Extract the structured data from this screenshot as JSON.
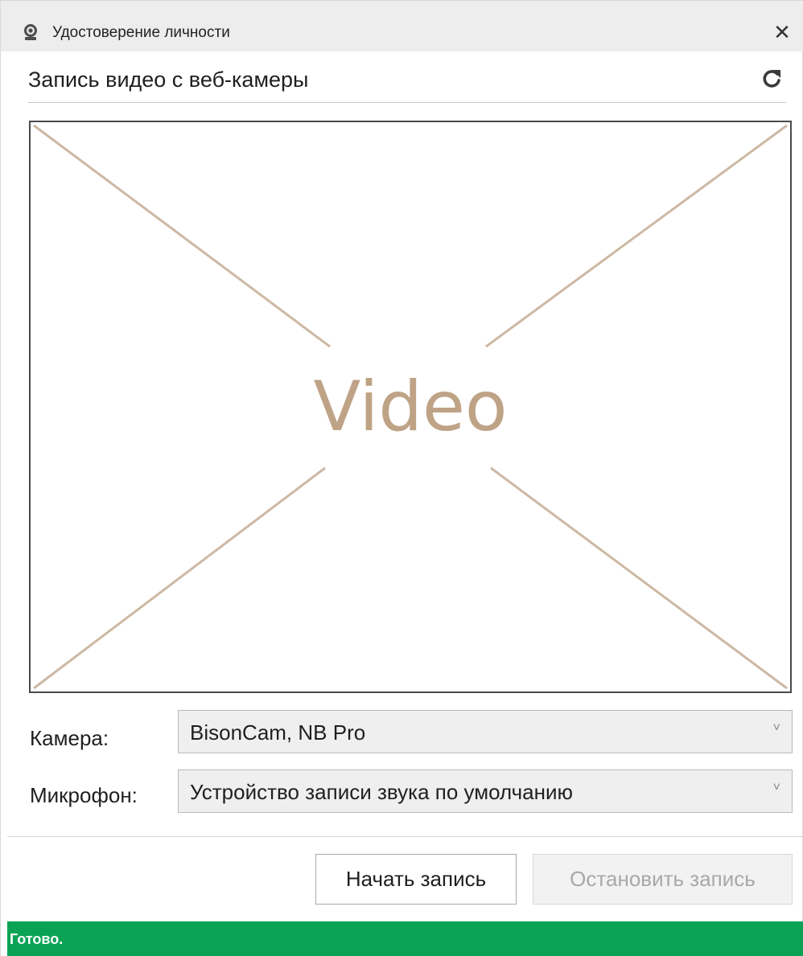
{
  "window": {
    "title": "Удостоверение личности",
    "app_icon": "webcam-icon",
    "close_icon": "close-icon",
    "close_glyph": "✕"
  },
  "header": {
    "heading": "Запись видео с веб-камеры",
    "refresh_icon": "refresh-icon"
  },
  "video": {
    "placeholder_text": "Video"
  },
  "form": {
    "camera_label": "Камера:",
    "camera_value": "BisonCam, NB Pro",
    "microphone_label": "Микрофон:",
    "microphone_value": "Устройство записи звука по умолчанию",
    "chevron_icon": "chevron-down-icon",
    "chevron_glyph": "˅"
  },
  "buttons": {
    "start_label": "Начать запись",
    "stop_label": "Остановить запись"
  },
  "status": {
    "text": "Готово."
  },
  "colors": {
    "status_bar": "#0aa356",
    "video_placeholder": "#bfa386"
  }
}
